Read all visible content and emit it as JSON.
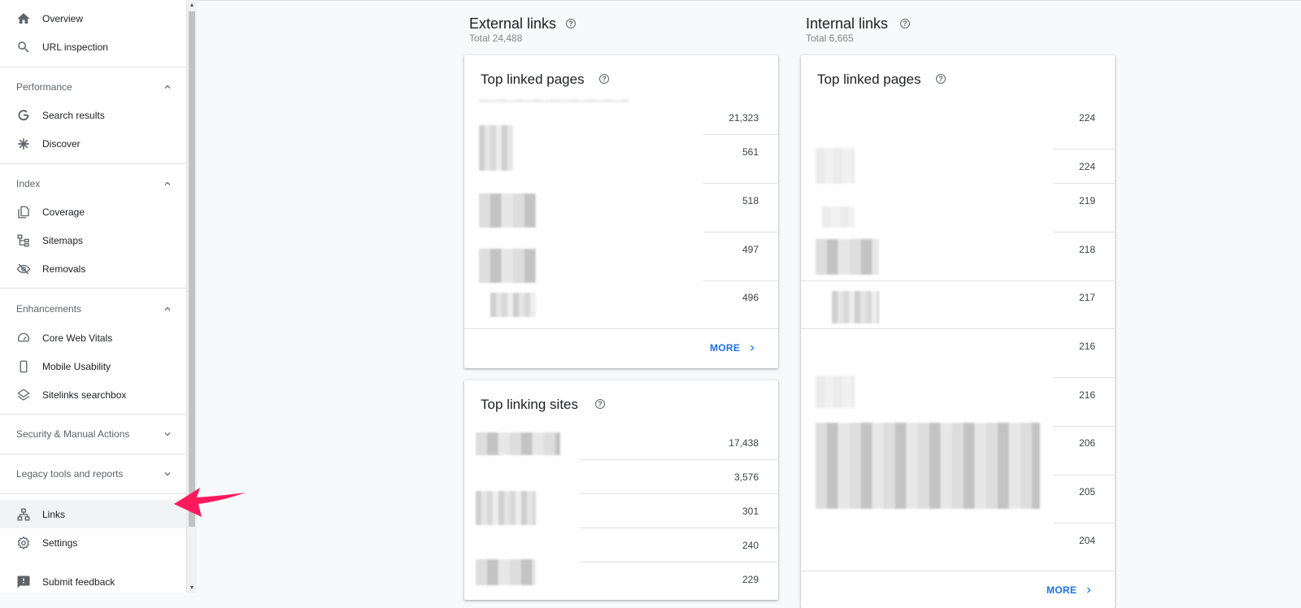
{
  "sidebar": {
    "overview": "Overview",
    "url_inspection": "URL inspection",
    "performance": {
      "header": "Performance",
      "items": [
        "Search results",
        "Discover"
      ]
    },
    "index": {
      "header": "Index",
      "items": [
        "Coverage",
        "Sitemaps",
        "Removals"
      ]
    },
    "enhancements": {
      "header": "Enhancements",
      "items": [
        "Core Web Vitals",
        "Mobile Usability",
        "Sitelinks searchbox"
      ]
    },
    "security": "Security & Manual Actions",
    "legacy": "Legacy tools and reports",
    "links": "Links",
    "settings": "Settings",
    "submit_feedback": "Submit feedback"
  },
  "external": {
    "title": "External links",
    "total": "Total 24,488",
    "top_linked_pages": {
      "title": "Top linked pages",
      "values": [
        "21,323",
        "561",
        "518",
        "497",
        "496"
      ],
      "more": "MORE"
    },
    "top_linking_sites": {
      "title": "Top linking sites",
      "values": [
        "17,438",
        "3,576",
        "301",
        "240",
        "229"
      ]
    }
  },
  "internal": {
    "title": "Internal links",
    "total": "Total 6,665",
    "top_linked_pages": {
      "title": "Top linked pages",
      "values": [
        "224",
        "224",
        "219",
        "218",
        "217",
        "216",
        "216",
        "206",
        "205",
        "204"
      ],
      "more": "MORE"
    }
  },
  "colors": {
    "accent": "#1a73e8",
    "annotation_arrow": "#ff1a5e"
  }
}
